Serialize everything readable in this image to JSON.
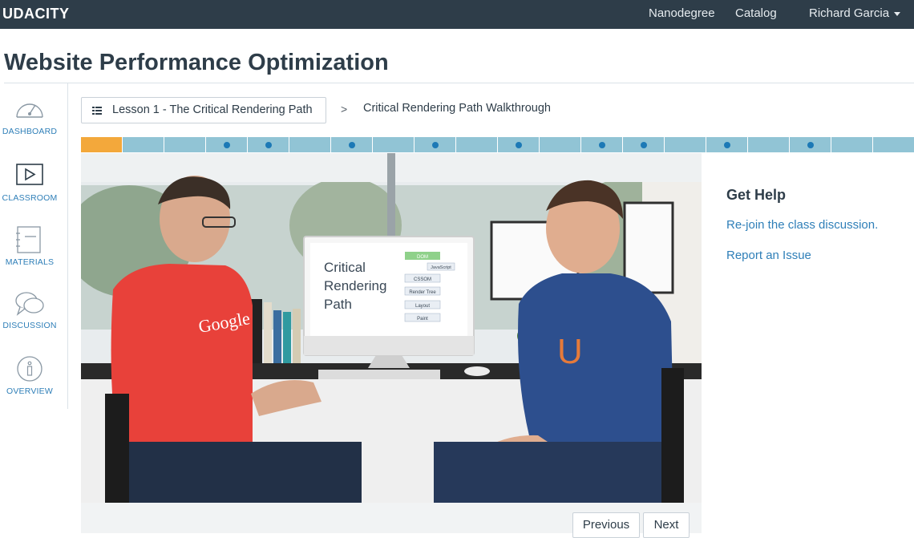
{
  "nav": {
    "brand": "UDACITY",
    "links": [
      "Nanodegree",
      "Catalog"
    ],
    "user": "Richard Garcia"
  },
  "page": {
    "title": "Website Performance Optimization"
  },
  "sidebar": {
    "items": [
      {
        "label": "DASHBOARD",
        "icon": "dashboard-gauge-icon"
      },
      {
        "label": "CLASSROOM",
        "icon": "play-icon"
      },
      {
        "label": "MATERIALS",
        "icon": "notes-icon"
      },
      {
        "label": "DISCUSSION",
        "icon": "chat-bubbles-icon"
      },
      {
        "label": "OVERVIEW",
        "icon": "info-icon"
      }
    ]
  },
  "breadcrumb": {
    "lesson": "Lesson 1 - The Critical Rendering Path",
    "separator": ">",
    "current": "Critical Rendering Path Walkthrough"
  },
  "progress": {
    "segment_count": 20,
    "active_index": 0,
    "quiz_dots": [
      3,
      4,
      6,
      8,
      10,
      12,
      13,
      15,
      17
    ],
    "colors": {
      "active": "#f3a83b",
      "inactive": "#91c4d5",
      "dot": "#1c79b6"
    }
  },
  "video": {
    "slide": {
      "title_lines": [
        "Critical",
        "Rendering",
        "Path"
      ],
      "diagram_nodes": [
        "DOM",
        "JavaScript",
        "CSSOM",
        "Render Tree",
        "Layout",
        "Paint"
      ]
    },
    "shirt_text": "Google"
  },
  "help": {
    "title": "Get Help",
    "links": [
      "Re-join the class discussion.",
      "Report an Issue"
    ]
  },
  "pager": {
    "previous": "Previous",
    "next": "Next"
  },
  "colors": {
    "nav_bg": "#2e3d49",
    "link": "#2f7fb8",
    "text": "#2e3d49"
  }
}
